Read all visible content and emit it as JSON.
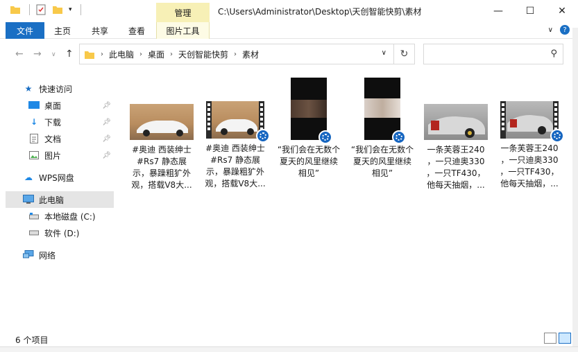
{
  "titlebar": {
    "manage_label": "管理",
    "path": "C:\\Users\\Administrator\\Desktop\\天创智能快剪\\素材",
    "minimize": "—",
    "maximize": "☐",
    "close": "✕"
  },
  "ribbon": {
    "file": "文件",
    "home": "主页",
    "share": "共享",
    "view": "查看",
    "picture_tools": "图片工具"
  },
  "address": {
    "crumbs": [
      "此电脑",
      "桌面",
      "天创智能快剪",
      "素材"
    ],
    "search_placeholder": ""
  },
  "sidebar": {
    "items": [
      {
        "label": "快速访问",
        "icon": "star-icon"
      },
      {
        "label": "桌面",
        "icon": "desktop-icon"
      },
      {
        "label": "下载",
        "icon": "download-icon"
      },
      {
        "label": "文档",
        "icon": "document-icon"
      },
      {
        "label": "图片",
        "icon": "picture-icon"
      },
      {
        "label": "WPS网盘",
        "icon": "cloud-icon"
      },
      {
        "label": "此电脑",
        "icon": "computer-icon"
      },
      {
        "label": "本地磁盘 (C:)",
        "icon": "drive-icon"
      },
      {
        "label": "软件 (D:)",
        "icon": "drive-icon"
      },
      {
        "label": "网络",
        "icon": "network-icon"
      }
    ]
  },
  "files": [
    {
      "name_lines": [
        "#奥迪 西装绅士",
        "#Rs7  静态展",
        "示，暴躁粗犷外",
        "观，搭载V8大..."
      ]
    },
    {
      "name_lines": [
        "#奥迪 西装绅士",
        "#Rs7  静态展",
        "示，暴躁粗犷外",
        "观，搭载V8大..."
      ]
    },
    {
      "name_lines": [
        "“我们会在无数个",
        "夏天的风里继续",
        "相见”"
      ]
    },
    {
      "name_lines": [
        "“我们会在无数个",
        "夏天的风里继续",
        "相见”"
      ]
    },
    {
      "name_lines": [
        "一条芙蓉王240",
        "，一只迪奥330",
        "，一只TF430，",
        "他每天抽烟，..."
      ]
    },
    {
      "name_lines": [
        "一条芙蓉王240",
        "，一只迪奥330",
        "，一只TF430，",
        "他每天抽烟，..."
      ]
    }
  ],
  "status": {
    "count": "6 个项目"
  },
  "colors": {
    "accent": "#1a6fc4",
    "manage_bg": "#f7f0b6",
    "selected": "#e5e5e5"
  }
}
